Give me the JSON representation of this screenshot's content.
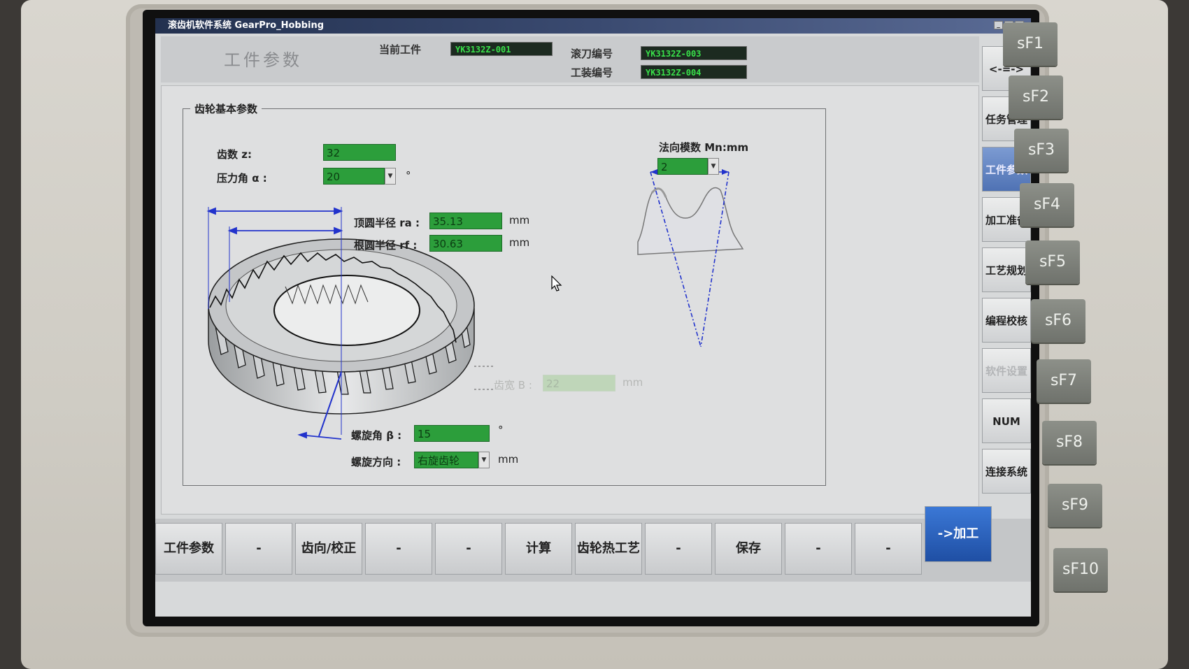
{
  "window": {
    "title": "滚齿机软件系统 GearPro_Hobbing"
  },
  "header": {
    "page_title": "工件参数",
    "current_workpiece_label": "当前工件",
    "current_workpiece_value": "YK3132Z-001",
    "hob_number_label": "滚刀编号",
    "hob_number_value": "YK3132Z-003",
    "fixture_number_label": "工装编号",
    "fixture_number_value": "YK3132Z-004"
  },
  "group": {
    "title": "齿轮基本参数"
  },
  "fields": {
    "teeth_label": "齿数 z:",
    "teeth_value": "32",
    "pressure_angle_label": "压力角 α :",
    "pressure_angle_value": "20",
    "pressure_angle_unit": "°",
    "normal_module_label": "法向模数 Mn:mm",
    "normal_module_value": "2",
    "tip_radius_label": "顶圆半径 ra :",
    "tip_radius_value": "35.13",
    "tip_radius_unit": "mm",
    "root_radius_label": "根圆半径 rf :",
    "root_radius_value": "30.63",
    "root_radius_unit": "mm",
    "face_width_label": "齿宽 B :",
    "face_width_value": "22",
    "face_width_unit": "mm",
    "helix_angle_label": "螺旋角 β :",
    "helix_angle_value": "15",
    "helix_angle_unit": "°",
    "helix_direction_label": "螺旋方向 :",
    "helix_direction_value": "右旋齿轮",
    "helix_direction_unit": "mm"
  },
  "sidebar": {
    "items": [
      {
        "label": "<-=->"
      },
      {
        "label": "任务管理"
      },
      {
        "label": "工件参数"
      },
      {
        "label": "加工准备"
      },
      {
        "label": "工艺规划"
      },
      {
        "label": "编程校核"
      },
      {
        "label": "软件设置"
      },
      {
        "label": "NUM HMI"
      },
      {
        "label": "连接系统"
      }
    ],
    "active_index": 2
  },
  "bottombar": {
    "keys": [
      "工件参数",
      "-",
      "齿向/校正",
      "-",
      "-",
      "计算",
      "齿轮热工艺",
      "-",
      "保存",
      "-",
      "-",
      "->加工"
    ]
  },
  "hardware_keys": [
    "sF1",
    "sF2",
    "sF3",
    "sF4",
    "sF5",
    "sF6",
    "sF7",
    "sF8",
    "sF9",
    "sF10"
  ],
  "colors": {
    "field_green": "#2c9e3b",
    "dimension_blue": "#2233cc",
    "active_tab": "#4f72b4",
    "go_button": "#1f4fa4"
  }
}
